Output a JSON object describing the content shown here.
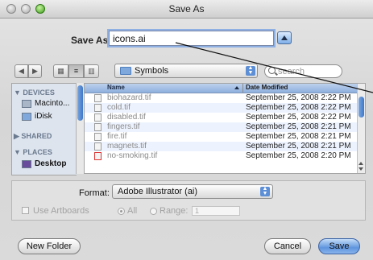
{
  "window": {
    "title": "Save As"
  },
  "save_as": {
    "label": "Save As:",
    "value": "icons.ai"
  },
  "toolbar": {
    "back": "◀",
    "forward": "▶",
    "view_icon": "▦",
    "view_list": "≡",
    "view_column": "▥",
    "location": "Symbols",
    "search_placeholder": "search"
  },
  "sidebar": {
    "devices_header": "▼ DEVICES",
    "devices": [
      "Macinto...",
      "iDisk"
    ],
    "shared_header": "▶ SHARED",
    "places_header": "▼ PLACES",
    "places": [
      "Desktop"
    ]
  },
  "file_list": {
    "columns": [
      "Name",
      "Date Modified"
    ],
    "rows": [
      {
        "name": "biohazard.tif",
        "date": "September 25, 2008 2:22 PM"
      },
      {
        "name": "cold.tif",
        "date": "September 25, 2008 2:22 PM"
      },
      {
        "name": "disabled.tif",
        "date": "September 25, 2008 2:22 PM"
      },
      {
        "name": "fingers.tif",
        "date": "September 25, 2008 2:21 PM"
      },
      {
        "name": "fire.tif",
        "date": "September 25, 2008 2:21 PM"
      },
      {
        "name": "magnets.tif",
        "date": "September 25, 2008 2:21 PM"
      },
      {
        "name": "no-smoking.tif",
        "date": "September 25, 2008 2:20 PM"
      }
    ]
  },
  "options": {
    "format_label": "Format:",
    "format_value": "Adobe Illustrator (ai)",
    "use_artboards": "Use Artboards",
    "all": "All",
    "range": "Range:",
    "range_value": "1"
  },
  "buttons": {
    "new_folder": "New Folder",
    "cancel": "Cancel",
    "save": "Save"
  }
}
